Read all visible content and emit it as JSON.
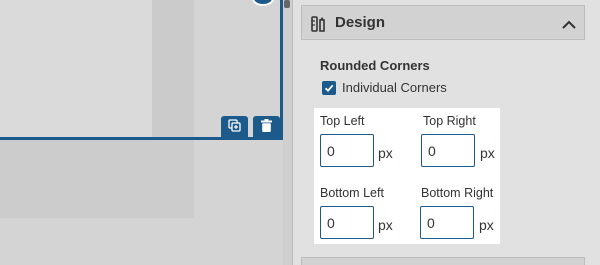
{
  "design": {
    "title": "Design",
    "rounded_corners": {
      "heading": "Rounded Corners",
      "individual_label": "Individual Corners",
      "individual_checked": true,
      "top_left": {
        "label": "Top Left",
        "value": "0",
        "unit": "px"
      },
      "top_right": {
        "label": "Top Right",
        "value": "0",
        "unit": "px"
      },
      "bottom_left": {
        "label": "Bottom Left",
        "value": "0",
        "unit": "px"
      },
      "bottom_right": {
        "label": "Bottom Right",
        "value": "0",
        "unit": "px"
      }
    }
  },
  "colors": {
    "accent": "#1c5a8c",
    "panel_bg": "#e1e1e1",
    "highlight_bg": "#ffffff"
  },
  "icons": {
    "copy": "duplicate-icon",
    "delete": "trash-icon",
    "design": "design-icon",
    "collapse": "chevron-up-icon"
  }
}
